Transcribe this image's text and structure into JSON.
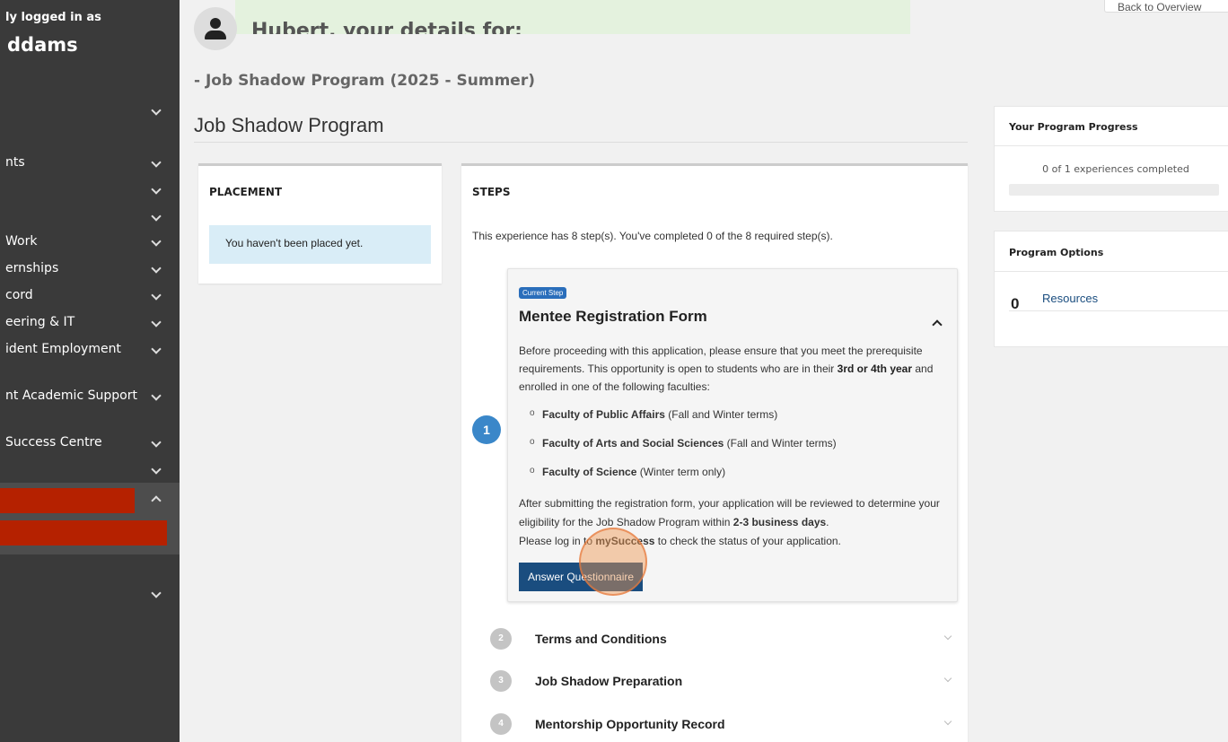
{
  "sidebar": {
    "logged_in_as": "ly logged in as",
    "user_name": "ddams",
    "items": [
      {
        "label": "",
        "expanded": false
      },
      {
        "label": "nts",
        "expanded": false
      },
      {
        "label": "",
        "expanded": false
      },
      {
        "label": "",
        "expanded": false
      },
      {
        "label": "Work",
        "expanded": false
      },
      {
        "label": "ernships",
        "expanded": false
      },
      {
        "label": "cord",
        "expanded": false
      },
      {
        "label": "eering & IT",
        "expanded": false
      },
      {
        "label": "ident Employment",
        "expanded": false
      },
      {
        "label": "nt Academic Support",
        "expanded": false
      },
      {
        "label": "Success Centre",
        "expanded": false
      },
      {
        "label": "",
        "expanded": false
      },
      {
        "label": "",
        "expanded": true
      },
      {
        "label": "",
        "expanded": false
      }
    ],
    "colors": {
      "background": "#3a3a3a",
      "redacted": "#b52100"
    }
  },
  "header": {
    "banner_text": "Hubert, your details for:",
    "back_button": "Back to Overview",
    "subtitle": "- Job Shadow Program (2025 - Summer)",
    "page_title": "Job Shadow Program"
  },
  "placement": {
    "heading": "PLACEMENT",
    "notice": "You haven't been placed yet."
  },
  "steps": {
    "heading": "STEPS",
    "summary": "This experience has 8 step(s). You've completed 0 of the 8 required step(s).",
    "current": {
      "number": "1",
      "badge": "Current Step",
      "title": "Mentee Registration Form",
      "intro_1": "Before proceeding with this application, please ensure that you meet the prerequisite requirements. This opportunity is open to students who are in their ",
      "intro_bold": "3rd or 4th year",
      "intro_2": " and enrolled in one of the following faculties:",
      "faculties": [
        {
          "name": "Faculty of Public Affairs",
          "terms": "(Fall and Winter terms)"
        },
        {
          "name": "Faculty of Arts and Social Sciences",
          "terms": "(Fall and Winter terms)"
        },
        {
          "name": "Faculty of Science",
          "terms": "(Winter term only)"
        }
      ],
      "after_1": "After submitting the registration form, your application will be reviewed to determine your eligibility for the Job Shadow Program within ",
      "after_bold": "2-3 business days",
      "after_2": ".",
      "login_1": "Please log in to ",
      "login_bold": "mySuccess",
      "login_2": " to check the status of your application.",
      "button": "Answer Questionnaire"
    },
    "collapsed": [
      {
        "number": "2",
        "title": "Terms and Conditions"
      },
      {
        "number": "3",
        "title": "Job Shadow Preparation"
      },
      {
        "number": "4",
        "title": "Mentorship Opportunity Record"
      }
    ]
  },
  "progress": {
    "heading": "Your Program Progress",
    "text": "0 of 1 experiences completed",
    "completed": 0,
    "total": 1
  },
  "options": {
    "heading": "Program Options",
    "count": "0",
    "link": "Resources"
  },
  "colors": {
    "accent": "#2a6ebb",
    "button": "#1a4d7f",
    "banner": "#e4f2de",
    "notice": "#d9edf7"
  }
}
